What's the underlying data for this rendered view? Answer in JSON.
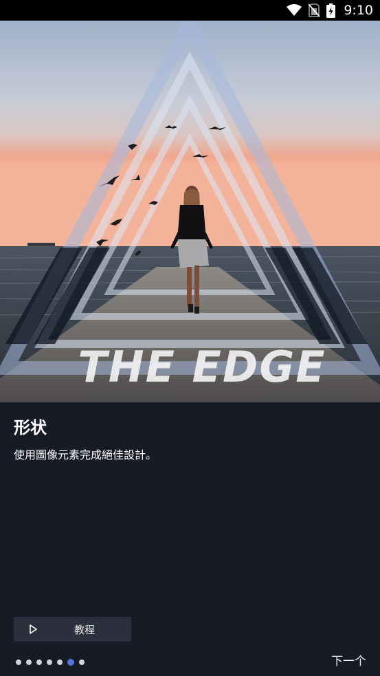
{
  "status_bar": {
    "time": "9:10",
    "icons": [
      "wifi-icon",
      "no-sim-icon",
      "battery-charging-icon"
    ]
  },
  "hero": {
    "overlay_text": "THE EDGE"
  },
  "feature": {
    "title": "形状",
    "description": "使用圖像元素完成絕佳設計。"
  },
  "tutorial_button": {
    "label": "教程",
    "icon": "play-icon"
  },
  "pager": {
    "total": 7,
    "active_index": 5
  },
  "next_button": {
    "label": "下一个"
  },
  "colors": {
    "background": "#171b26",
    "button_bg": "#2b303c",
    "dot_active": "#5a6ee6",
    "dot_inactive": "#cfd2d8"
  }
}
